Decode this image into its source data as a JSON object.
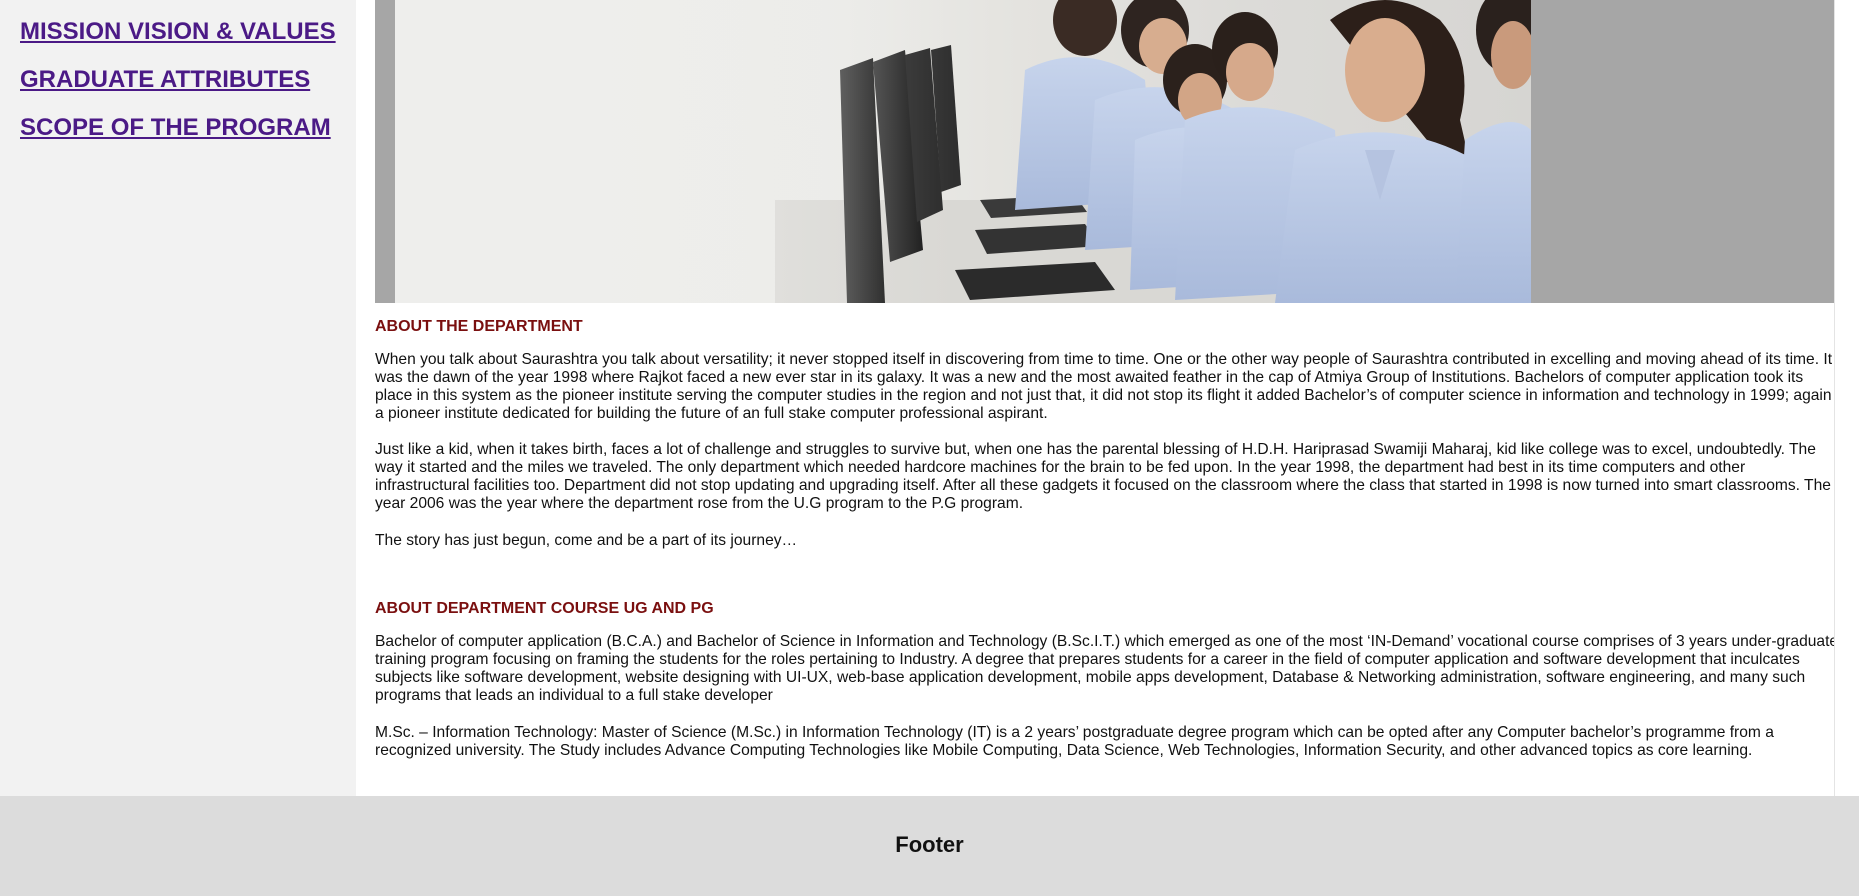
{
  "sidebar": {
    "items": [
      {
        "label": "MISSION VISION & VALUES"
      },
      {
        "label": "GRADUATE ATTRIBUTES"
      },
      {
        "label": "SCOPE OF THE PROGRAM"
      }
    ]
  },
  "colors": {
    "link": "#4b1a86",
    "heading": "#7a0f0f",
    "sidebar_bg": "#f2f2f2",
    "footer_bg": "#dcdcdc",
    "hero_frame": "#a6a6a6"
  },
  "hero": {
    "image_subject": "students-at-computers-photo"
  },
  "about_department": {
    "heading": "ABOUT THE DEPARTMENT",
    "paragraphs": [
      "When you talk about Saurashtra you talk about versatility; it never stopped itself in discovering from time to time. One or the other way people of Saurashtra contributed in excelling and moving ahead of its time. It was the dawn of the year 1998 where Rajkot faced a new ever star in its galaxy. It was a new and the most awaited feather in the cap of Atmiya Group of Institutions. Bachelors of computer application took its place in this system as the pioneer institute serving the computer studies in the region and not just that, it did not stop its flight it added Bachelor’s of computer science in information and technology in 1999; again a pioneer institute dedicated for building the future of an full stake computer professional aspirant.",
      "Just like a kid, when it takes birth, faces a lot of challenge and struggles to survive but, when one has the parental blessing of H.D.H. Hariprasad Swamiji Maharaj, kid like college was to excel, undoubtedly. The way it started and the miles we traveled. The only department which needed hardcore machines for the brain to be fed upon. In the year 1998, the department had best in its time computers and other infrastructural facilities too. Department did not stop updating and upgrading itself. After all these gadgets it focused on the classroom where the class that started in 1998 is now turned into smart classrooms. The year 2006 was the year where the department rose from the U.G program to the P.G program.",
      "The story has just begun, come and be a part of its journey…"
    ]
  },
  "about_course": {
    "heading": "ABOUT DEPARTMENT COURSE UG AND PG",
    "paragraphs": [
      "Bachelor of computer application (B.C.A.) and Bachelor of Science in Information and Technology (B.Sc.I.T.) which emerged as one of the most ‘IN-Demand’ vocational course comprises of 3 years under-graduate training program focusing on framing the students for the roles pertaining to Industry. A degree that prepares students for a career in the field of computer application and software development that inculcates subjects like software development, website designing with UI-UX, web-base application development, mobile apps development, Database & Networking administration, software engineering, and many such programs that leads an individual to a full stake developer",
      "M.Sc. – Information Technology: Master of Science (M.Sc.) in Information Technology (IT) is a 2 years’ postgraduate degree program which can be opted after any Computer bachelor’s programme from a recognized university. The Study includes Advance Computing Technologies like Mobile Computing, Data Science, Web Technologies, Information Security, and other advanced topics as core learning."
    ]
  },
  "footer": {
    "label": "Footer"
  }
}
